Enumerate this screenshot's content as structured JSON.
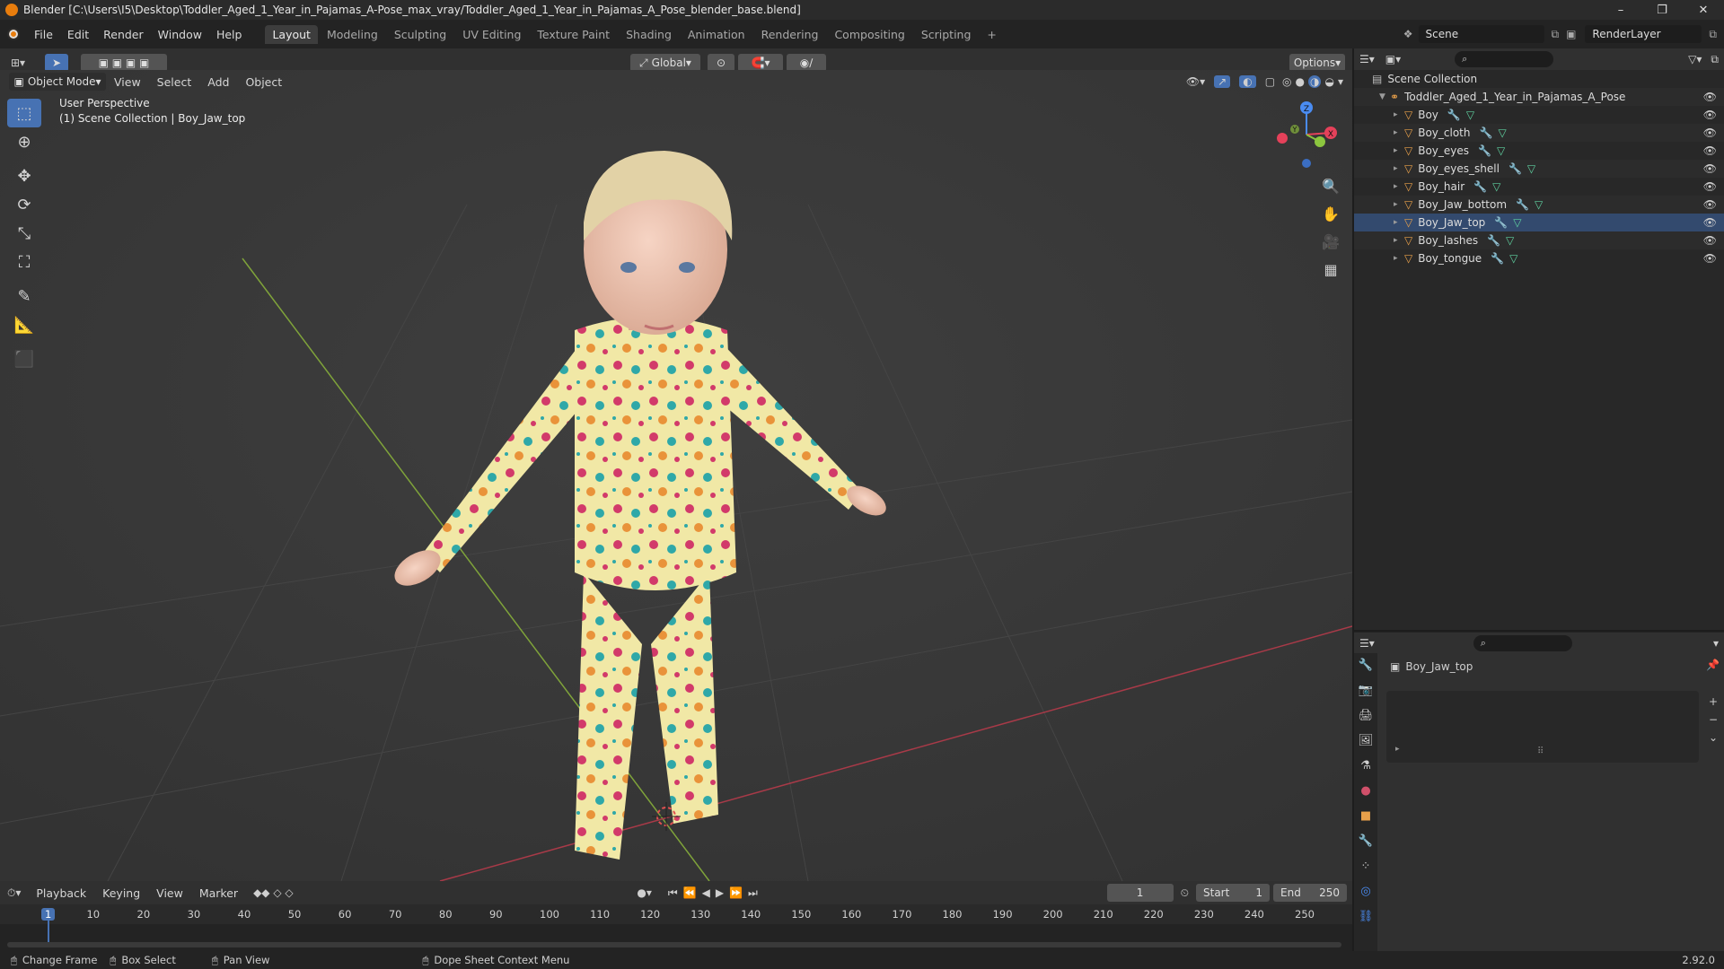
{
  "window": {
    "title": "Blender [C:\\Users\\I5\\Desktop\\Toddler_Aged_1_Year_in_Pajamas_A-Pose_max_vray/Toddler_Aged_1_Year_in_Pajamas_A_Pose_blender_base.blend]",
    "controls": [
      "–",
      "❐",
      "✕"
    ]
  },
  "menu": [
    "File",
    "Edit",
    "Render",
    "Window",
    "Help"
  ],
  "workspaces": [
    "Layout",
    "Modeling",
    "Sculpting",
    "UV Editing",
    "Texture Paint",
    "Shading",
    "Animation",
    "Rendering",
    "Compositing",
    "Scripting"
  ],
  "active_workspace": "Layout",
  "scene": {
    "name": "Scene",
    "render_layer": "RenderLayer"
  },
  "header": {
    "transform_orientation": "Global",
    "options_label": "Options"
  },
  "viewport": {
    "mode": "Object Mode",
    "menus": [
      "View",
      "Select",
      "Add",
      "Object"
    ],
    "info_line1": "User Perspective",
    "info_line2": "(1) Scene Collection | Boy_Jaw_top",
    "gizmo_axes": {
      "x": "X",
      "y": "Y",
      "z": "Z"
    }
  },
  "outliner": {
    "root": "Scene Collection",
    "collection": "Toddler_Aged_1_Year_in_Pajamas_A_Pose",
    "objects": [
      "Boy",
      "Boy_cloth",
      "Boy_eyes",
      "Boy_eyes_shell",
      "Boy_hair",
      "Boy_Jaw_bottom",
      "Boy_Jaw_top",
      "Boy_lashes",
      "Boy_tongue"
    ]
  },
  "properties": {
    "object_name": "Boy_Jaw_top"
  },
  "timeline": {
    "menus": [
      "Playback",
      "Keying",
      "View",
      "Marker"
    ],
    "current_frame": "1",
    "start_label": "Start",
    "start_value": "1",
    "end_label": "End",
    "end_value": "250",
    "ruler": [
      "1",
      "10",
      "20",
      "30",
      "40",
      "50",
      "60",
      "70",
      "80",
      "90",
      "100",
      "110",
      "120",
      "130",
      "140",
      "150",
      "160",
      "170",
      "180",
      "190",
      "200",
      "210",
      "220",
      "230",
      "240",
      "250"
    ]
  },
  "statusbar": {
    "items": [
      "Change Frame",
      "Box Select",
      "Pan View",
      "Dope Sheet Context Menu"
    ],
    "version": "2.92.0"
  },
  "colors": {
    "accent": "#4772b3",
    "orange": "#e87d0d",
    "axis_x": "#e5415a",
    "axis_y": "#8cc63f",
    "axis_z": "#4a8cf2"
  }
}
